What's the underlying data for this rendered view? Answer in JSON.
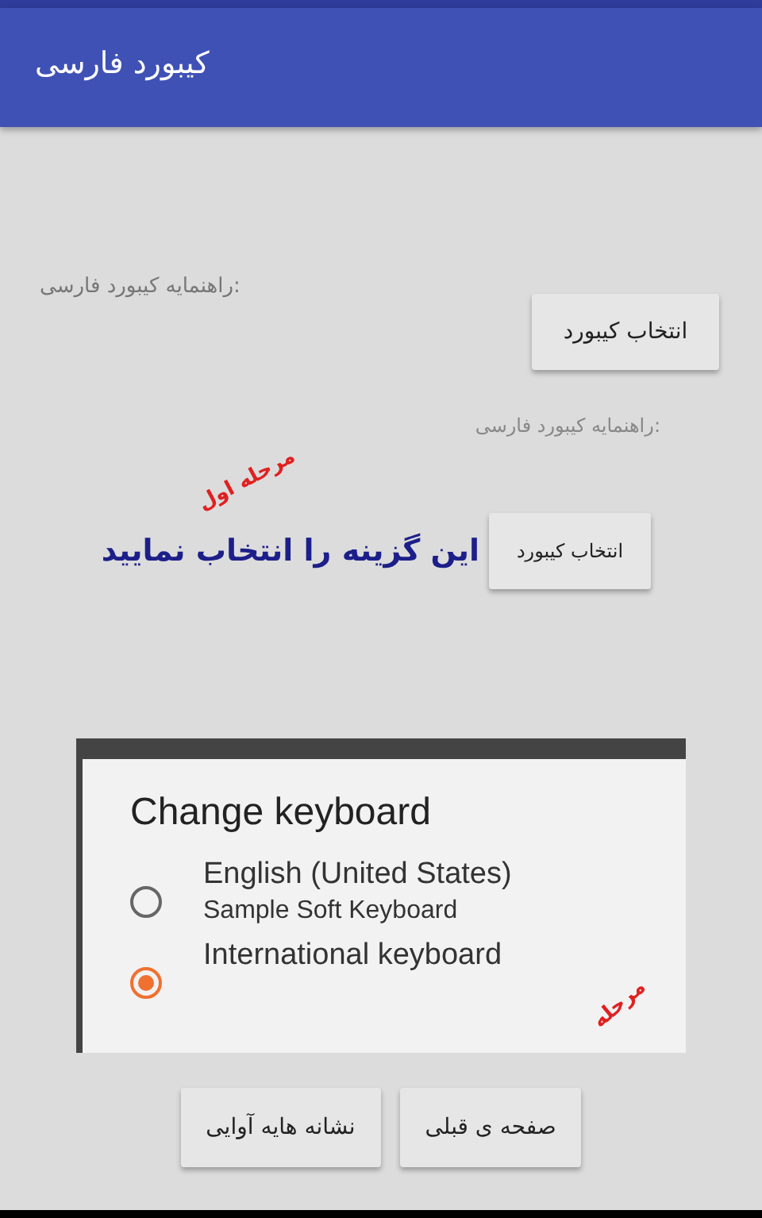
{
  "app_bar": {
    "title": "کیبورد فارسی"
  },
  "guide_label": "راهنمایه کیبورد فارسی:",
  "choose_button": "انتخاب کیبورد",
  "tutorial": {
    "guide_label": "راهنمایه کیبورد فارسی:",
    "step_label": "مرحله اول",
    "instruction": "این گزینه را انتخاب نمایید",
    "choose_button": "انتخاب کیبورد",
    "dialog": {
      "title": "Change keyboard",
      "options": [
        {
          "label": "English (United States)",
          "sublabel": "Sample Soft Keyboard",
          "selected": false
        },
        {
          "label": "International keyboard",
          "selected": true
        }
      ]
    },
    "step_label_2": "مرحله"
  },
  "buttons": [
    "صفحه ی قبلی",
    "نشانه هایه آوایی"
  ]
}
